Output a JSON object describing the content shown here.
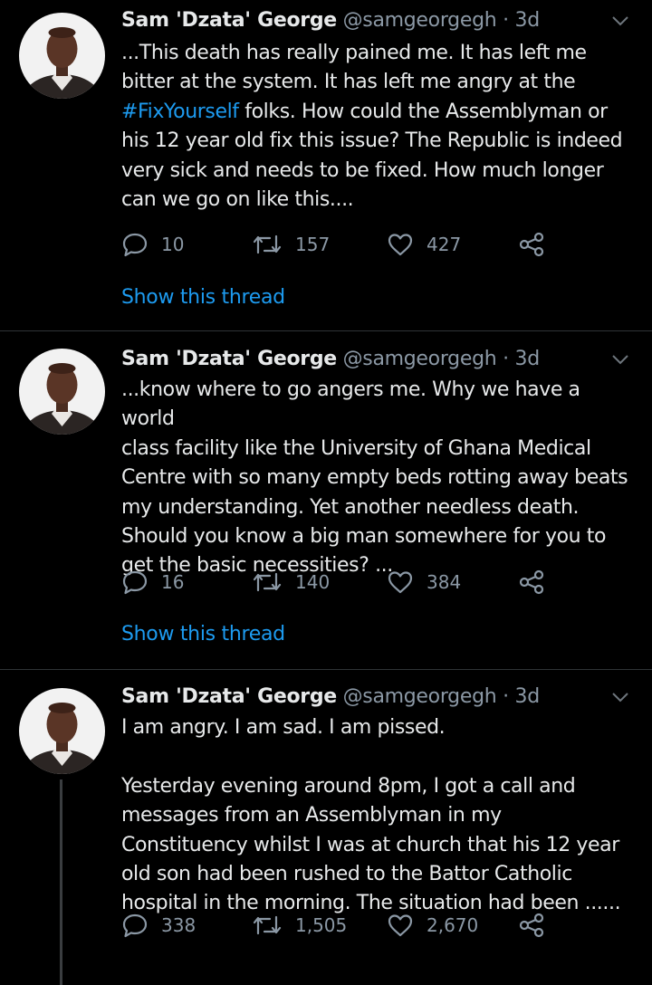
{
  "colors": {
    "background": "#000000",
    "text": "#e7e9ea",
    "muted": "#8b98a5",
    "link": "#1d9bf0",
    "divider": "#2f3336"
  },
  "tweets": [
    {
      "author_name": "Sam 'Dzata' George",
      "handle": "@samgeorgegh",
      "separator": " · ",
      "time": "3d",
      "text_lines": [
        "...This death has really pained me. It has left me",
        "bitter at the system. It has left me angry at the",
        "#FixYourself",
        " folks. How could the Assemblyman or",
        "his 12 year old fix this issue? The Republic is indeed",
        "very sick and needs to be fixed. How much longer",
        "can we go on like this...."
      ],
      "replies": "10",
      "retweets": "157",
      "likes": "427",
      "show_thread": "Show this thread",
      "icons": [
        "reply-icon",
        "retweet-icon",
        "like-icon",
        "share-icon",
        "chevron-down-icon"
      ]
    },
    {
      "author_name": "Sam 'Dzata' George",
      "handle": "@samgeorgegh",
      "separator": " · ",
      "time": "3d",
      "text": "...know where to go angers me. Why we have a world\nclass facility like the University of Ghana Medical\nCentre with so many empty beds rotting away beats\nmy understanding. Yet another needless death.\nShould you know a big man somewhere for you to\nget the basic necessities? ...",
      "replies": "16",
      "retweets": "140",
      "likes": "384",
      "show_thread": "Show this thread"
    },
    {
      "author_name": "Sam 'Dzata' George",
      "handle": "@samgeorgegh",
      "separator": " · ",
      "time": "3d",
      "text": "I am angry. I am sad. I am pissed.\n\nYesterday evening around 8pm, I got a call and\nmessages from an Assemblyman in my\nConstituency whilst I was at church that his 12 year\nold son had been rushed to the Battor Catholic\nhospital in the morning. The situation had been ......",
      "replies": "338",
      "retweets": "1,505",
      "likes": "2,670"
    }
  ]
}
